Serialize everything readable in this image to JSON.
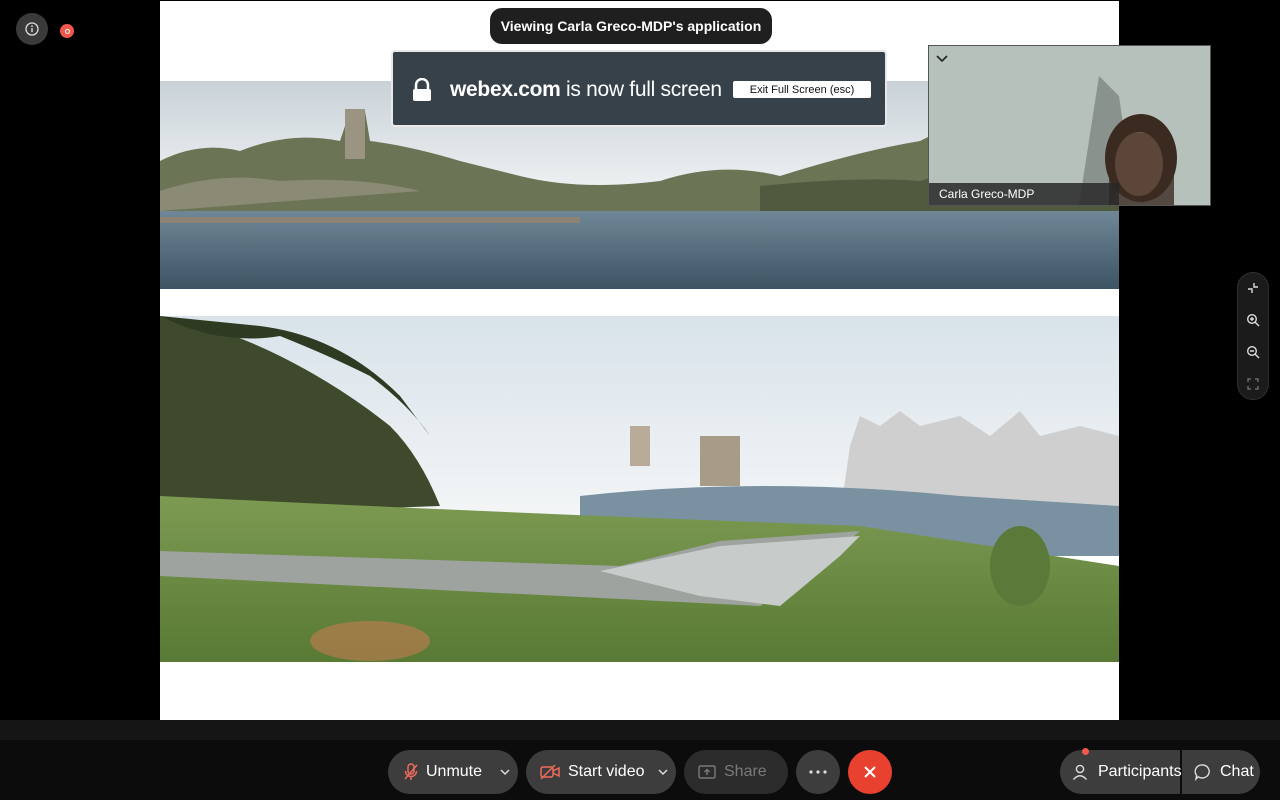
{
  "banner": {
    "viewing_text": "Viewing Carla Greco-MDP's application"
  },
  "fullscreen_notice": {
    "domain": "webex.com",
    "message": " is now full screen",
    "exit_label": "Exit Full Screen (esc)"
  },
  "participant_video": {
    "name": "Carla Greco-MDP"
  },
  "toolbar": {
    "unmute_label": "Unmute",
    "start_video_label": "Start video",
    "share_label": "Share",
    "participants_label": "Participants",
    "chat_label": "Chat"
  },
  "colors": {
    "end_call": "#e8412f",
    "recording": "#f0584b",
    "fullscreen_notice_bg": "#37414a"
  },
  "icons": {
    "info": "info-icon",
    "recording": "recording-icon",
    "lock": "lock-icon",
    "collapse": "chevron-down-icon",
    "exit_fullscreen": "minimize-icon",
    "zoom_in": "zoom-in-icon",
    "zoom_out": "zoom-out-icon",
    "fit": "fit-screen-icon",
    "mic": "mic-off-icon",
    "video": "video-off-icon",
    "share": "share-icon",
    "more": "more-icon",
    "end": "close-icon",
    "participants": "person-icon",
    "chat": "chat-icon"
  }
}
